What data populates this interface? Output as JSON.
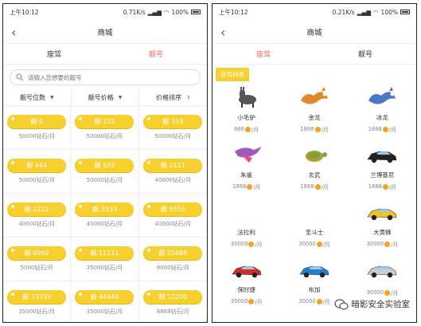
{
  "left": {
    "status": {
      "time": "上午10:12",
      "speed": "0.71K/s",
      "battery": "100%"
    },
    "nav": {
      "title": "商城"
    },
    "tabs": [
      {
        "label": "座驾"
      },
      {
        "label": "靓号"
      }
    ],
    "search": {
      "placeholder": "请输入您想要的靓号"
    },
    "filters": [
      {
        "label": "靓号位数"
      },
      {
        "label": "靓号价格"
      },
      {
        "label": "价格排序"
      }
    ],
    "numbers": [
      {
        "label": "靓 0",
        "price": "50000钻石/月"
      },
      {
        "label": "靓 222",
        "price": "50000钻石/月"
      },
      {
        "label": "靓 333",
        "price": "50000钻石/月"
      },
      {
        "label": "靓 444",
        "price": "50000钻石/月"
      },
      {
        "label": "靓 555",
        "price": "50000钻石/月"
      },
      {
        "label": "靓 1111",
        "price": "40000钻石/月"
      },
      {
        "label": "靓 2222",
        "price": "40000钻石/月"
      },
      {
        "label": "靓 3333",
        "price": "40000钻石/月"
      },
      {
        "label": "靓 5555",
        "price": "40000钻石/月"
      },
      {
        "label": "靓 6969",
        "price": "5000钻石/月"
      },
      {
        "label": "靓 11111",
        "price": "35000钻石/月"
      },
      {
        "label": "靓 25888",
        "price": "9000钻石/月"
      },
      {
        "label": "靓 33333",
        "price": "35000钻石/月"
      },
      {
        "label": "靓 44444",
        "price": "35000钻石/月"
      },
      {
        "label": "靓 52200",
        "price": "8888钻石/月"
      }
    ]
  },
  "right": {
    "status": {
      "time": "上午10:12",
      "speed": "0.21K/s",
      "battery": "100%"
    },
    "nav": {
      "title": "商城"
    },
    "tabs": [
      {
        "label": "座驾"
      },
      {
        "label": "靓号"
      }
    ],
    "section_label": "座驾列表",
    "mounts": [
      {
        "name": "小毛驴",
        "price": "666",
        "unit": "/月",
        "icon": "donkey-icon",
        "color": "#555555"
      },
      {
        "name": "金龙",
        "price": "1888",
        "unit": "/月",
        "icon": "golden-dragon-icon",
        "color": "#e0892b"
      },
      {
        "name": "冰龙",
        "price": "1888",
        "unit": "/月",
        "icon": "ice-dragon-icon",
        "color": "#4a78c8"
      },
      {
        "name": "朱雀",
        "price": "1888",
        "unit": "/月",
        "icon": "phoenix-icon",
        "color": "#a25ab8"
      },
      {
        "name": "玄武",
        "price": "1888",
        "unit": "/月",
        "icon": "turtle-icon",
        "color": "#b59a2e"
      },
      {
        "name": "兰博基尼",
        "price": "1888",
        "unit": "/月",
        "icon": "lamborghini-car-icon",
        "color": "#222222"
      },
      {
        "name": "法拉利",
        "price": "30000",
        "unit": "/月",
        "icon": "ferrari-car-icon",
        "color": "#ffffff"
      },
      {
        "name": "圣斗士",
        "price": "30000",
        "unit": "/月",
        "icon": "saint-car-icon",
        "color": "#ffffff"
      },
      {
        "name": "大黄蜂",
        "price": "30000",
        "unit": "/月",
        "icon": "bumblebee-car-icon",
        "color": "#f2c21b"
      },
      {
        "name": "保时捷",
        "price": "30000",
        "unit": "/月",
        "icon": "porsche-car-icon",
        "color": "#d62a2a"
      },
      {
        "name": "布加",
        "price": "30000",
        "unit": "/月",
        "icon": "bugatti-car-icon",
        "color": "#1f7fd1"
      },
      {
        "name": "",
        "price": "30000",
        "unit": "/月",
        "icon": "silver-car-icon",
        "color": "#cccccc"
      }
    ],
    "watermark": "暗影安全实验室"
  }
}
